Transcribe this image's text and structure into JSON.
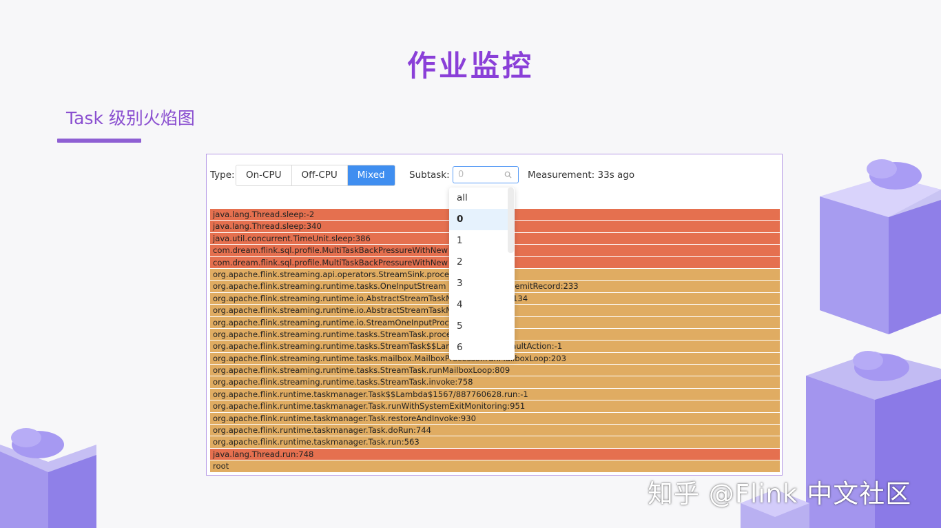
{
  "slide": {
    "title": "作业监控",
    "section_title": "Task 级别火焰图"
  },
  "toolbar": {
    "type_label": "Type:",
    "type_options": [
      "On-CPU",
      "Off-CPU",
      "Mixed"
    ],
    "type_selected": "Mixed",
    "subtask_label": "Subtask:",
    "subtask_value": "0",
    "measurement": "Measurement: 33s ago"
  },
  "dropdown": {
    "options": [
      "all",
      "0",
      "1",
      "2",
      "3",
      "4",
      "5",
      "6"
    ],
    "selected": "0"
  },
  "flame_frames": [
    {
      "text": "java.lang.Thread.sleep:-2",
      "color": "#e5704f"
    },
    {
      "text": "java.lang.Thread.sleep:340",
      "color": "#e5704f"
    },
    {
      "text": "java.util.concurrent.TimeUnit.sleep:386",
      "color": "#e5704f"
    },
    {
      "text": "com.dream.flink.sql.profile.MultiTaskBackPressureWithNew                              :44",
      "color": "#e5704f"
    },
    {
      "text": "com.dream.flink.sql.profile.MultiTaskBackPressureWithNew                              :39",
      "color": "#e5704f"
    },
    {
      "text": "org.apache.flink.streaming.api.operators.StreamSink.proce",
      "color": "#e0ac62"
    },
    {
      "text": "org.apache.flink.streaming.runtime.tasks.OneInputStream                          :NetworkOutput.emitRecord:233",
      "color": "#e0ac62"
    },
    {
      "text": "org.apache.flink.streaming.runtime.io.AbstractStreamTaskN                          ocessElement:134",
      "color": "#e0ac62"
    },
    {
      "text": "org.apache.flink.streaming.runtime.io.AbstractStreamTaskN                          itNext:105",
      "color": "#e0ac62"
    },
    {
      "text": "org.apache.flink.streaming.runtime.io.StreamOneInputProc                          ut:65",
      "color": "#e0ac62"
    },
    {
      "text": "org.apache.flink.streaming.runtime.tasks.StreamTask.proce",
      "color": "#e0ac62"
    },
    {
      "text": "org.apache.flink.streaming.runtime.tasks.StreamTask$$Lam                          39602.runDefaultAction:-1",
      "color": "#e0ac62"
    },
    {
      "text": "org.apache.flink.streaming.runtime.tasks.mailbox.MailboxProcessor.runMailboxLoop:203",
      "color": "#e0ac62"
    },
    {
      "text": "org.apache.flink.streaming.runtime.tasks.StreamTask.runMailboxLoop:809",
      "color": "#e0ac62"
    },
    {
      "text": "org.apache.flink.streaming.runtime.tasks.StreamTask.invoke:758",
      "color": "#e0ac62"
    },
    {
      "text": "org.apache.flink.runtime.taskmanager.Task$$Lambda$1567/887760628.run:-1",
      "color": "#e0ac62"
    },
    {
      "text": "org.apache.flink.runtime.taskmanager.Task.runWithSystemExitMonitoring:951",
      "color": "#e0ac62"
    },
    {
      "text": "org.apache.flink.runtime.taskmanager.Task.restoreAndInvoke:930",
      "color": "#e0ac62"
    },
    {
      "text": "org.apache.flink.runtime.taskmanager.Task.doRun:744",
      "color": "#e0ac62"
    },
    {
      "text": "org.apache.flink.runtime.taskmanager.Task.run:563",
      "color": "#e0ac62"
    },
    {
      "text": "java.lang.Thread.run:748",
      "color": "#e5704f"
    },
    {
      "text": "root",
      "color": "#e0ac62"
    }
  ],
  "watermark": "知乎 @Flink 中文社区",
  "colors": {
    "accent": "#8a3fd8",
    "button_active": "#3f8ef0",
    "hot_frame": "#e5704f",
    "warm_frame": "#e0ac62"
  }
}
